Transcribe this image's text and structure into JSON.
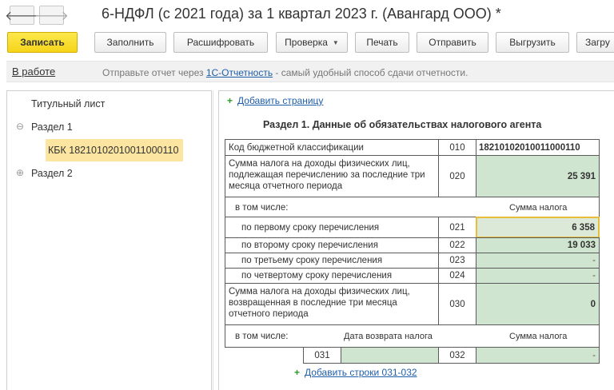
{
  "window": {
    "title": "6-НДФЛ (с 2021 года) за 1 квартал 2023 г. (Авангард ООО) *",
    "back_glyph": "🡐",
    "forward_glyph": "🡒"
  },
  "toolbar": {
    "save": "Записать",
    "fill": "Заполнить",
    "decode": "Расшифровать",
    "check": "Проверка",
    "print": "Печать",
    "send": "Отправить",
    "export": "Выгрузить",
    "load": "Загру"
  },
  "infobar": {
    "status": "В работе",
    "msg_before": "Отправьте отчет через ",
    "msg_link": "1С-Отчетность",
    "msg_after": " - самый удобный способ сдачи отчетности."
  },
  "tree": {
    "title_page": "Титульный лист",
    "section1": "Раздел 1",
    "kbk_item": "КБК 18210102010011000110",
    "section2": "Раздел 2",
    "collapse_glyph": "⊖",
    "expand_glyph": "⊕"
  },
  "form": {
    "add_page": "Добавить страницу",
    "section_title": "Раздел 1. Данные об обязательствах налогового агента",
    "kbk_label": "Код бюджетной классификации",
    "kbk_code": "010",
    "kbk_value": "18210102010011000110",
    "r020_label": "Сумма налога на доходы физических лиц, подлежащая перечислению за последние три месяца отчетного периода",
    "r020_code": "020",
    "r020_value": "25 391",
    "incl_label": "в том числе:",
    "tax_sum_header": "Сумма налога",
    "r021_label": "по первому сроку перечисления",
    "r021_code": "021",
    "r021_value": "6 358",
    "r022_label": "по второму сроку перечисления",
    "r022_code": "022",
    "r022_value": "19 033",
    "r023_label": "по третьему сроку перечисления",
    "r023_code": "023",
    "r023_value": "-",
    "r024_label": "по четвертому сроку перечисления",
    "r024_code": "024",
    "r024_value": "-",
    "r030_label": "Сумма налога на доходы физических лиц, возвращенная в последние три месяца отчетного периода",
    "r030_code": "030",
    "r030_value": "0",
    "incl2_label": "в том числе:",
    "return_date_header": "Дата возврата налога",
    "tax_sum_header2": "Сумма налога",
    "r031_code": "031",
    "r031_value": "",
    "r032_code": "032",
    "r032_value": "-",
    "add_rows": "Добавить строки 031-032",
    "plus_glyph": "+"
  }
}
